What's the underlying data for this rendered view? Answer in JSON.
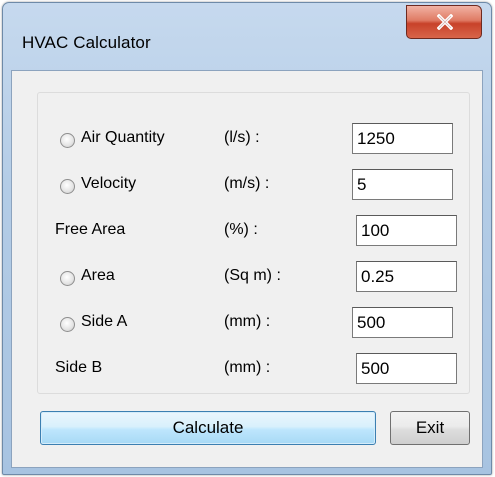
{
  "window": {
    "title": "HVAC Calculator"
  },
  "fields": [
    {
      "radio": true,
      "label": "Air Quantity",
      "unit": "(l/s) :",
      "value": "1250"
    },
    {
      "radio": true,
      "label": "Velocity",
      "unit": "(m/s) :",
      "value": "5"
    },
    {
      "radio": false,
      "label": "Free Area",
      "unit": "(%) :",
      "value": "100"
    },
    {
      "radio": true,
      "label": "Area",
      "unit": "(Sq m) :",
      "value": "0.25"
    },
    {
      "radio": true,
      "label": "Side A",
      "unit": "(mm) :",
      "value": "500"
    },
    {
      "radio": false,
      "label": "Side B",
      "unit": "(mm) :",
      "value": "500"
    }
  ],
  "buttons": {
    "calculate": "Calculate",
    "exit": "Exit"
  },
  "icons": {
    "close": "close-icon",
    "radio": "radio-unselected"
  },
  "colors": {
    "close_button": "#c8422a",
    "calculate_border": "#3c7fb1",
    "window_frame": "#b3cce6"
  }
}
